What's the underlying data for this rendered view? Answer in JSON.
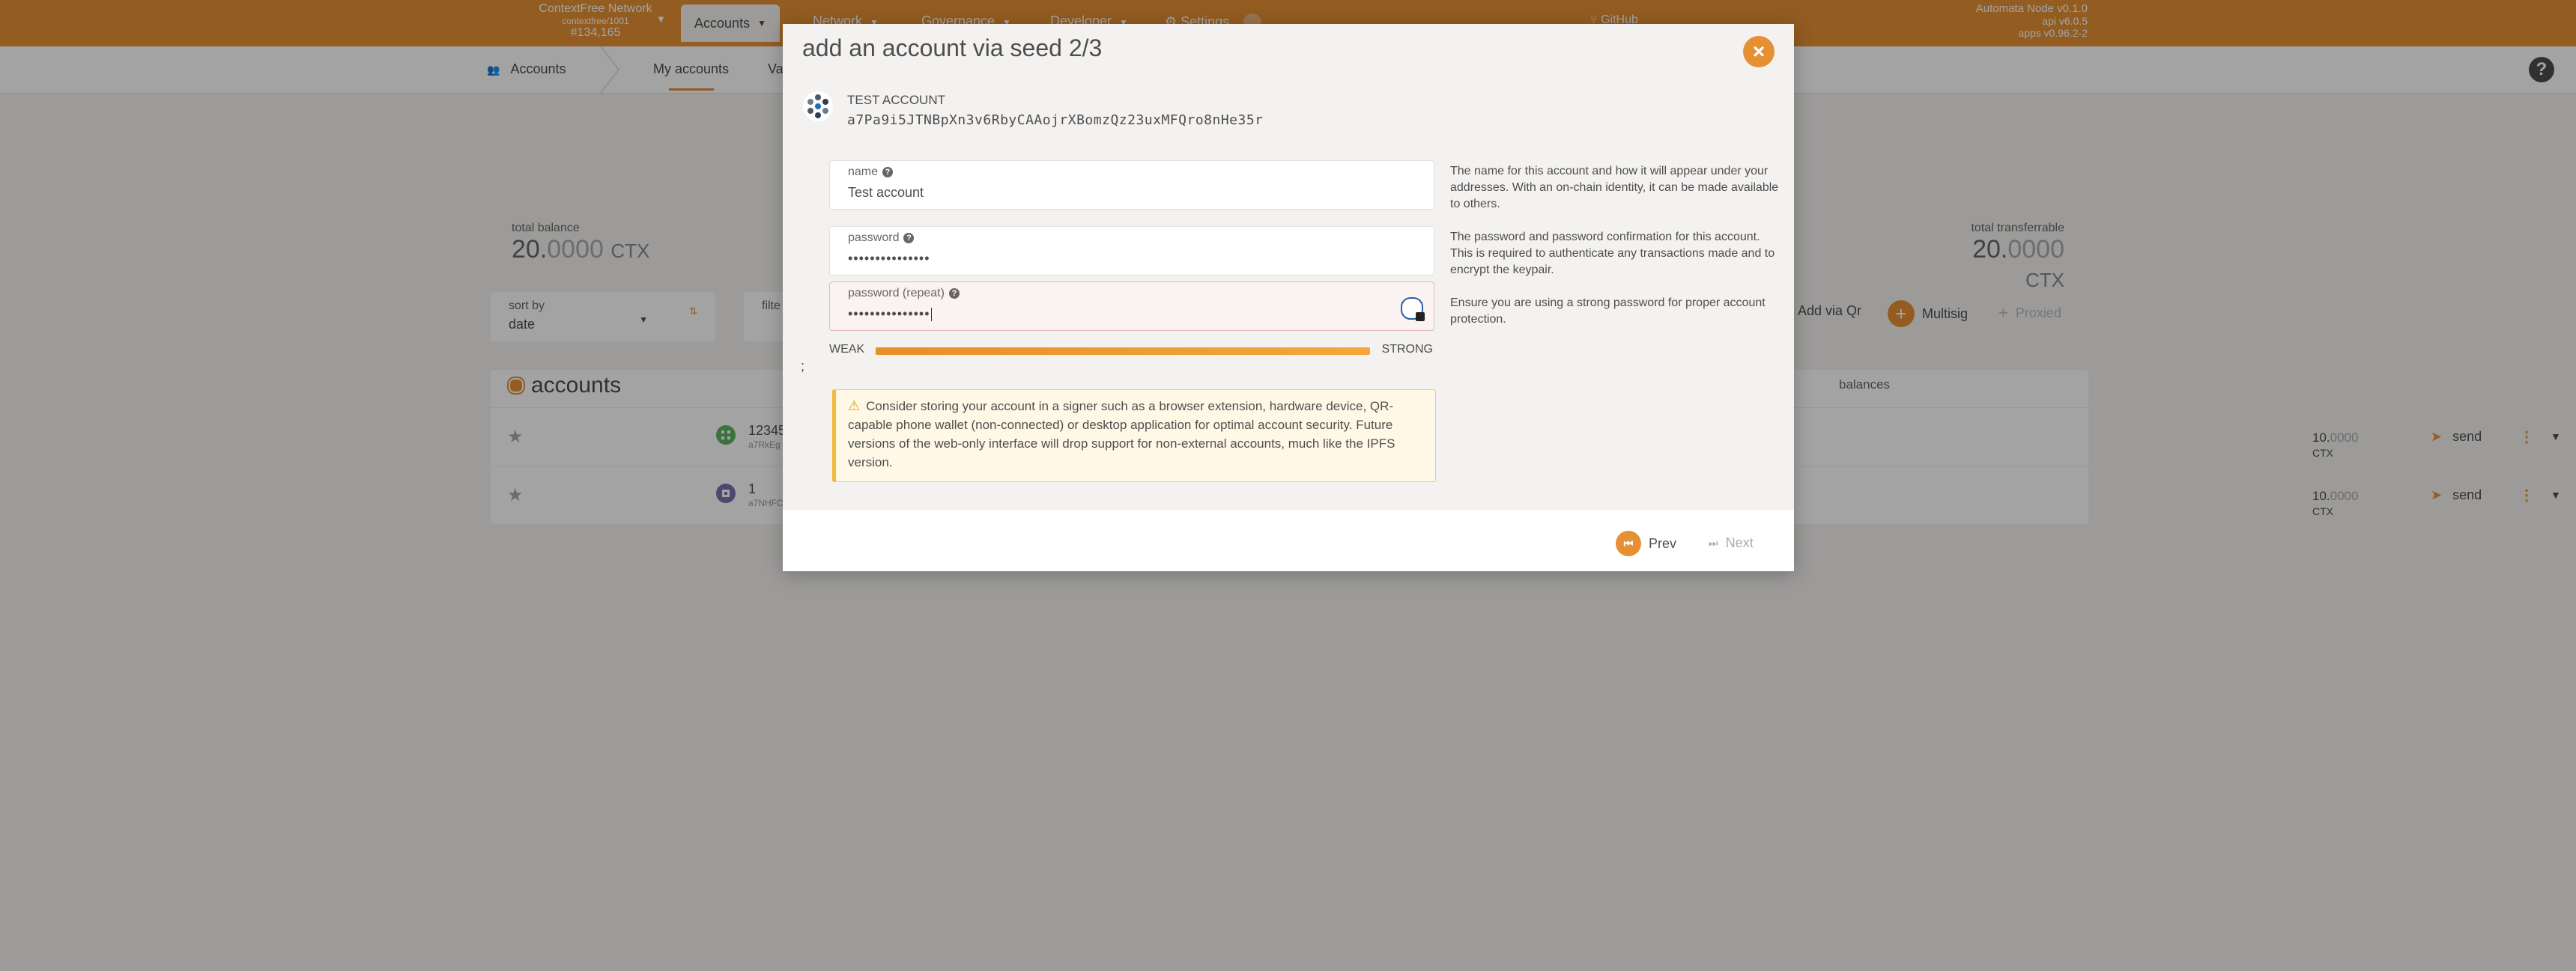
{
  "topbar": {
    "network_name": "ContextFree Network",
    "network_sub": "contextfree/1001",
    "block_number": "#134,165",
    "tabs": [
      "Accounts",
      "Network",
      "Governance",
      "Developer",
      "Settings"
    ],
    "github": "GitHub",
    "version": [
      "Automata Node v0.1.0",
      "api v6.0.5",
      "apps v0.96.2-2"
    ]
  },
  "subnav": {
    "accounts_label": "Accounts",
    "my_accounts": "My accounts",
    "partial_tab": "Va"
  },
  "summary": {
    "total_balance_label": "total balance",
    "total_balance_int": "20.",
    "total_balance_dec": "0000",
    "total_transferrable_label": "total transferrable",
    "total_transferrable_int": "20.",
    "total_transferrable_dec": "0000",
    "unit": "CTX"
  },
  "controls": {
    "sort_label": "sort by",
    "sort_value": "date",
    "filter_label": "filte",
    "add_via_qr": "Add via Qr",
    "multisig": "Multisig",
    "proxied": "Proxied"
  },
  "accounts_table": {
    "title": "accounts",
    "balances_header": "balances",
    "rows": [
      {
        "name": "12345",
        "address": "a7RkEg",
        "balance_int": "10.",
        "balance_dec": "0000",
        "unit": "CTX",
        "send": "send"
      },
      {
        "name": "1",
        "address": "a7NHFC",
        "balance_int": "10.",
        "balance_dec": "0000",
        "unit": "CTX",
        "send": "send"
      }
    ]
  },
  "modal": {
    "title": "add an account via seed 2/3",
    "account_name": "TEST ACCOUNT",
    "account_address": "a7Pa9i5JTNBpXn3v6RbyCAAojrXBomzQz23uxMFQro8nHe35r",
    "name_label": "name",
    "name_value": "Test account",
    "name_help": "The name for this account and how it will appear under your addresses. With an on-chain identity, it can be made available to others.",
    "password_label": "password",
    "password_value": "•••••••••••••••",
    "password_help": "The password and password confirmation for this account. This is required to authenticate any transactions made and to encrypt the keypair.",
    "password_repeat_label": "password (repeat)",
    "password_repeat_value": "•••••••••••••••",
    "password_repeat_help": "Ensure you are using a strong password for proper account protection.",
    "strength_weak": "WEAK",
    "strength_strong": "STRONG",
    "strength_level": 1.0,
    "stray_text": ";",
    "warning": "Consider storing your account in a signer such as a browser extension, hardware device, QR-capable phone wallet (non-connected) or desktop application for optimal account security. Future versions of the web-only interface will drop support for non-external accounts, much like the IPFS version.",
    "prev_label": "Prev",
    "next_label": "Next"
  },
  "colors": {
    "accent": "#e69034",
    "warning_border": "#f1b940"
  }
}
